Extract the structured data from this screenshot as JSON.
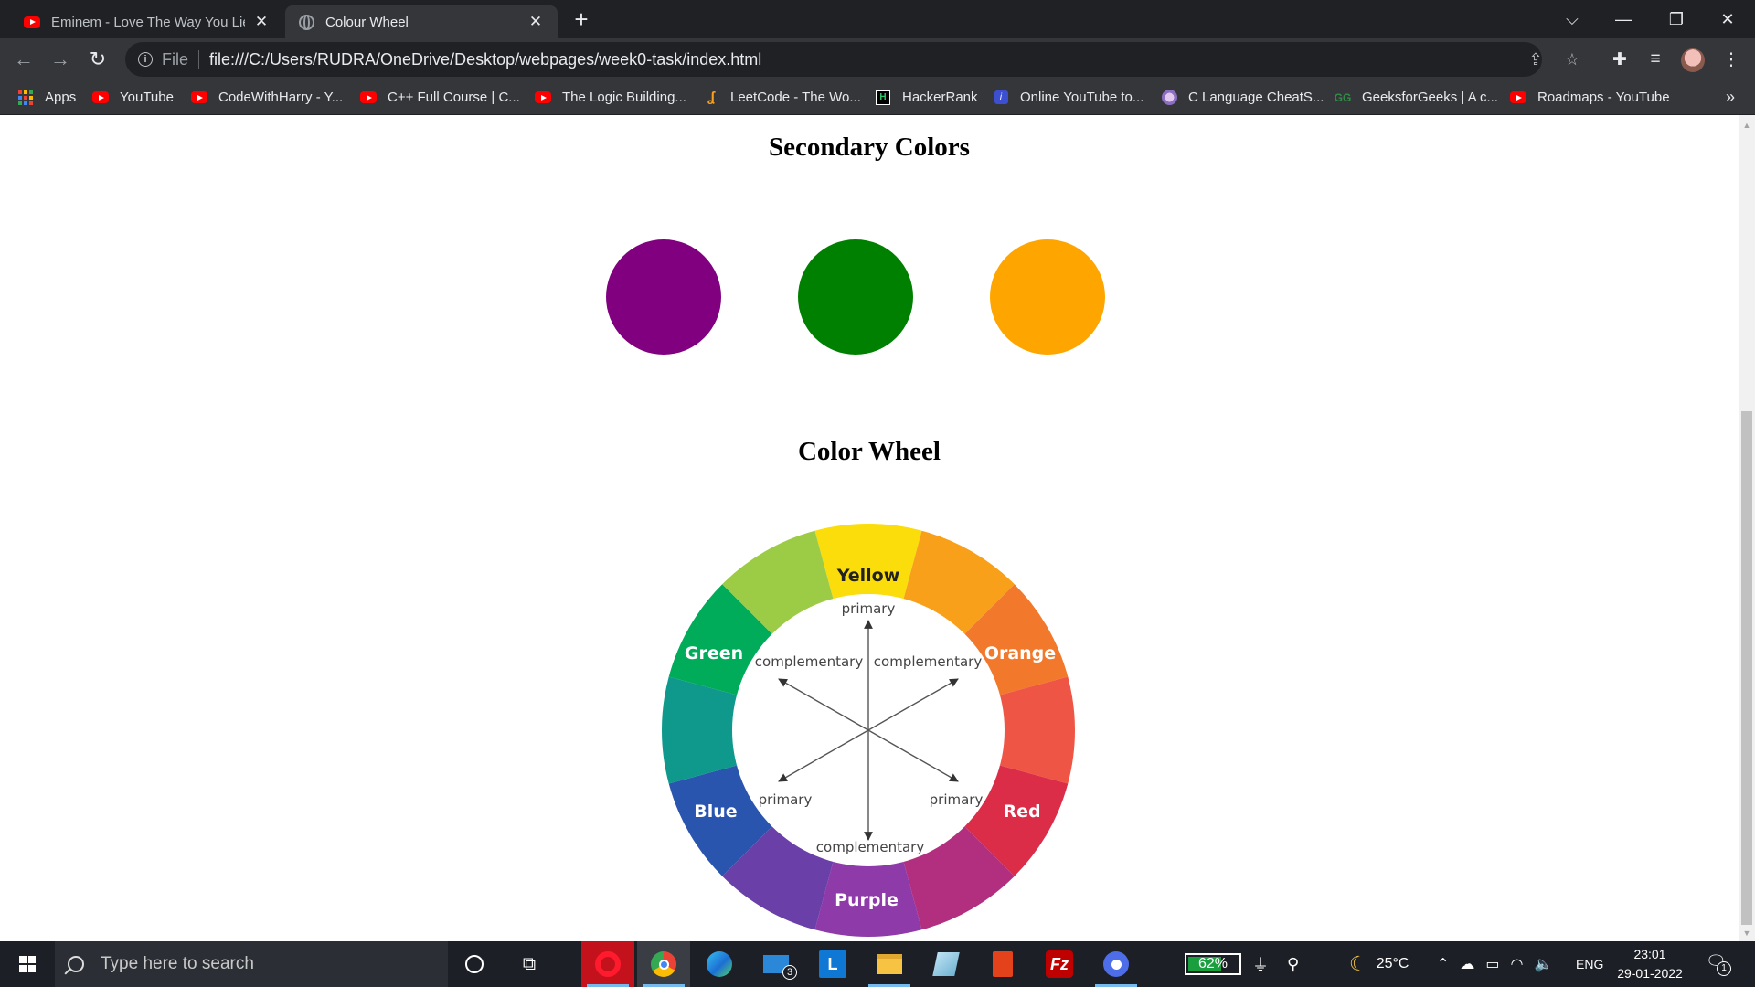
{
  "browser": {
    "tabs": [
      {
        "title": "Eminem - Love The Way You Lie (",
        "favicon": "youtube-icon",
        "active": false
      },
      {
        "title": "Colour Wheel",
        "favicon": "globe-icon",
        "active": true
      }
    ],
    "address": {
      "scheme": "File",
      "url": "file:///C:/Users/RUDRA/OneDrive/Desktop/webpages/week0-task/index.html"
    },
    "bookmarks": [
      {
        "label": "Apps",
        "icon": "apps-grid-icon"
      },
      {
        "label": "YouTube",
        "icon": "youtube-icon"
      },
      {
        "label": "CodeWithHarry - Y...",
        "icon": "youtube-icon"
      },
      {
        "label": "C++ Full Course | C...",
        "icon": "youtube-icon"
      },
      {
        "label": "The Logic Building...",
        "icon": "youtube-icon"
      },
      {
        "label": "LeetCode - The Wo...",
        "icon": "leetcode-icon"
      },
      {
        "label": "HackerRank",
        "icon": "hackerrank-icon"
      },
      {
        "label": "Online YouTube to...",
        "icon": "converter-icon"
      },
      {
        "label": "C Language CheatS...",
        "icon": "cheatsheet-icon"
      },
      {
        "label": "GeeksforGeeks | A c...",
        "icon": "geeksforgeeks-icon"
      },
      {
        "label": "Roadmaps - YouTube",
        "icon": "youtube-icon"
      }
    ],
    "bookmarks_more": "»"
  },
  "page": {
    "secondary_heading": "Secondary Colors",
    "secondary_colors": [
      {
        "name": "purple",
        "hex": "#800080"
      },
      {
        "name": "green",
        "hex": "#008000"
      },
      {
        "name": "orange",
        "hex": "#FFA500"
      }
    ],
    "wheel_heading": "Color Wheel",
    "wheel": {
      "segment_labels": {
        "yellow": "Yellow",
        "orange": "Orange",
        "red": "Red",
        "purple": "Purple",
        "blue": "Blue",
        "green": "Green"
      },
      "inner_labels": {
        "top": "primary",
        "upper_left": "complementary",
        "upper_right": "complementary",
        "lower_left": "primary",
        "lower_right": "primary",
        "bottom": "complementary"
      },
      "segment_colors": [
        "#FBDD0C",
        "#F8A01A",
        "#F2782B",
        "#EF5544",
        "#DB2D48",
        "#B22E7E",
        "#8E3BA9",
        "#6A3FA8",
        "#2A55AE",
        "#0E998C",
        "#00AB5A",
        "#9CCC46"
      ]
    }
  },
  "taskbar": {
    "search_placeholder": "Type here to search",
    "battery_percent": "62%",
    "weather": "25°C",
    "language": "ENG",
    "time": "23:01",
    "date": "29-01-2022",
    "notification_count": "1",
    "mail_badge": "3"
  }
}
